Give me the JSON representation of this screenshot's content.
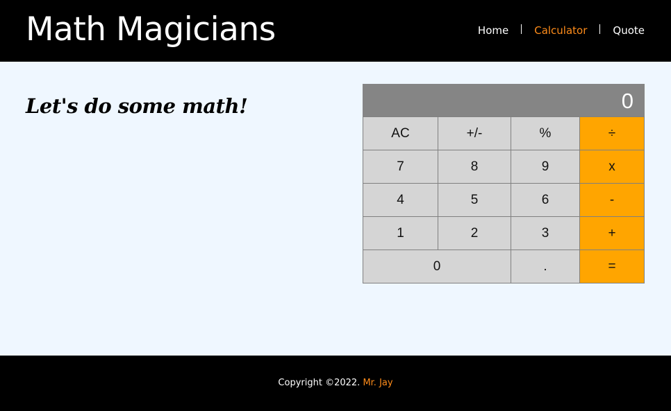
{
  "header": {
    "logo": "Math Magicians",
    "nav": [
      {
        "label": "Home",
        "active": false
      },
      {
        "label": "Calculator",
        "active": true
      },
      {
        "label": "Quote",
        "active": false
      }
    ]
  },
  "main": {
    "headline": "Let's do some math!"
  },
  "calculator": {
    "display_value": "0",
    "keys": [
      {
        "label": "AC",
        "type": "function"
      },
      {
        "label": "+/-",
        "type": "function"
      },
      {
        "label": "%",
        "type": "function"
      },
      {
        "label": "÷",
        "type": "operator"
      },
      {
        "label": "7",
        "type": "digit"
      },
      {
        "label": "8",
        "type": "digit"
      },
      {
        "label": "9",
        "type": "digit"
      },
      {
        "label": "x",
        "type": "operator"
      },
      {
        "label": "4",
        "type": "digit"
      },
      {
        "label": "5",
        "type": "digit"
      },
      {
        "label": "6",
        "type": "digit"
      },
      {
        "label": "-",
        "type": "operator"
      },
      {
        "label": "1",
        "type": "digit"
      },
      {
        "label": "2",
        "type": "digit"
      },
      {
        "label": "3",
        "type": "digit"
      },
      {
        "label": "+",
        "type": "operator"
      },
      {
        "label": "0",
        "type": "digit"
      },
      {
        "label": ".",
        "type": "digit"
      },
      {
        "label": "=",
        "type": "operator"
      }
    ],
    "colors": {
      "display_bg": "#858585",
      "key_bg": "#d5d5d5",
      "operator_bg": "#ffa500"
    }
  },
  "footer": {
    "copyright": "Copyright ©2022.",
    "author": "Mr. Jay"
  },
  "colors": {
    "accent": "#ff8c1a",
    "page_bg": "#eff7ff",
    "bar_bg": "#000000"
  }
}
